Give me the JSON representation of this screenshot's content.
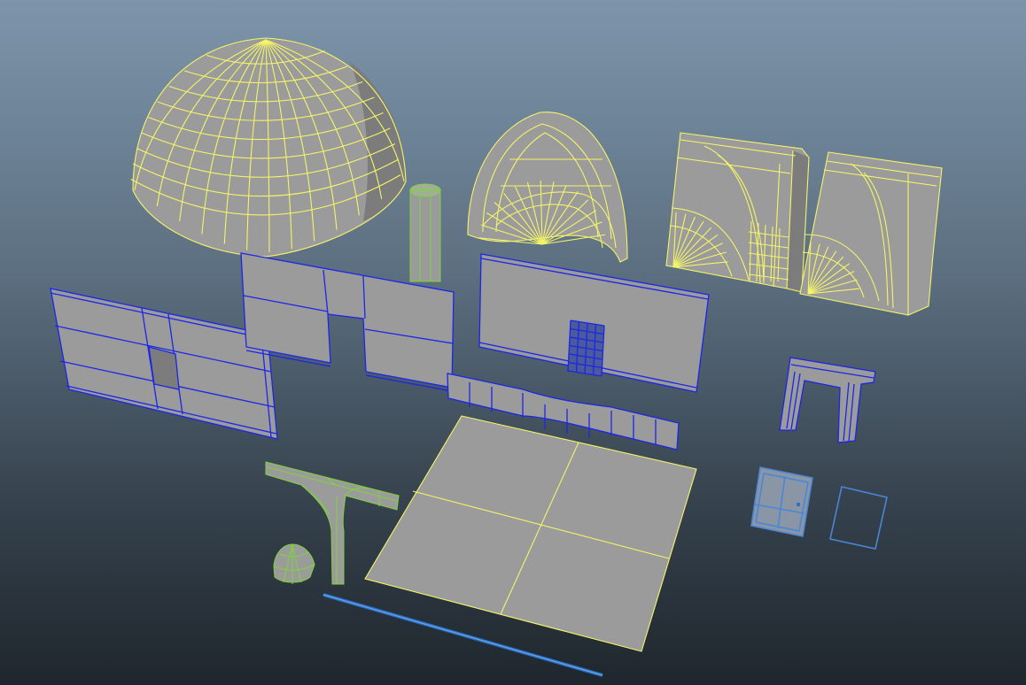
{
  "viewport": {
    "kind": "3d-viewport",
    "display_mode": "wireframe-on-shaded",
    "background": [
      "#7d95ab",
      "#34404b",
      "#1f262d"
    ]
  },
  "selection_colors": {
    "active_object": "#f4f46a",
    "selected": "#1c26e6",
    "lead_selected": "#7fd33a",
    "template": "#4a86d6"
  },
  "scene_objects": [
    {
      "id": "dome",
      "selection": "active_object"
    },
    {
      "id": "column",
      "selection": "lead_selected"
    },
    {
      "id": "arch-vault",
      "selection": "active_object"
    },
    {
      "id": "arch-block-1",
      "selection": "active_object"
    },
    {
      "id": "arch-block-2",
      "selection": "active_object"
    },
    {
      "id": "wall-with-window",
      "selection": "selected"
    },
    {
      "id": "wall-with-doorway",
      "selection": "selected"
    },
    {
      "id": "wall-with-grate",
      "selection": "selected"
    },
    {
      "id": "curved-trim",
      "selection": "selected"
    },
    {
      "id": "door-frame",
      "selection": "selected"
    },
    {
      "id": "floor-plane",
      "selection": "active_object"
    },
    {
      "id": "lamp-post",
      "selection": "lead_selected"
    },
    {
      "id": "lamp-shade",
      "selection": "lead_selected"
    },
    {
      "id": "rod",
      "selection": "template"
    },
    {
      "id": "window-pane",
      "selection": "template"
    },
    {
      "id": "window-frame",
      "selection": "template"
    }
  ]
}
